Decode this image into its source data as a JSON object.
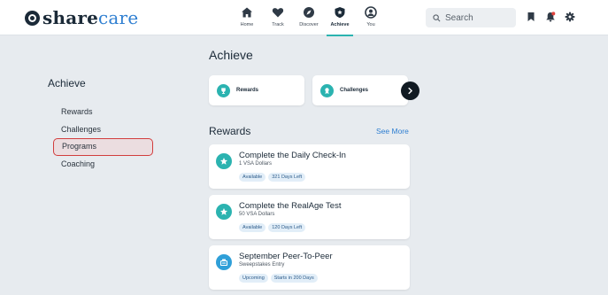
{
  "brand": {
    "share": "share",
    "care": "care"
  },
  "nav": [
    {
      "label": "Home",
      "icon": "home-icon"
    },
    {
      "label": "Track",
      "icon": "heart-icon"
    },
    {
      "label": "Discover",
      "icon": "compass-icon"
    },
    {
      "label": "Achieve",
      "icon": "shield-icon"
    },
    {
      "label": "You",
      "icon": "user-icon"
    }
  ],
  "search": {
    "placeholder": "Search"
  },
  "top_icons": [
    "bookmark-icon",
    "notification-bell-icon",
    "settings-gear-icon"
  ],
  "sidebar": {
    "title": "Achieve",
    "items": [
      {
        "label": "Rewards"
      },
      {
        "label": "Challenges"
      },
      {
        "label": "Programs"
      },
      {
        "label": "Coaching"
      }
    ]
  },
  "main": {
    "title": "Achieve",
    "tiles": [
      {
        "label": "Rewards",
        "icon": "trophy-icon"
      },
      {
        "label": "Challenges",
        "icon": "challenge-icon"
      }
    ],
    "rewards_title": "Rewards",
    "see_more": "See More",
    "cards": [
      {
        "title": "Complete the Daily Check-In",
        "subtitle": "1 VSA Dollars",
        "badges": [
          "Available",
          "321 Days Left"
        ],
        "icon": "star-icon"
      },
      {
        "title": "Complete the RealAge Test",
        "subtitle": "50 VSA Dollars",
        "badges": [
          "Available",
          "120 Days Left"
        ],
        "icon": "star-icon"
      },
      {
        "title": "September Peer-To-Peer",
        "subtitle": "Sweepstakes Entry",
        "badges": [
          "Upcoming",
          "Starts in 200 Days"
        ],
        "icon": "sweepstakes-icon"
      }
    ]
  },
  "colors": {
    "accent": "#2bb3b0",
    "link": "#2f7fd1",
    "highlight_border": "#d23d3d",
    "background": "#e7ebef"
  }
}
